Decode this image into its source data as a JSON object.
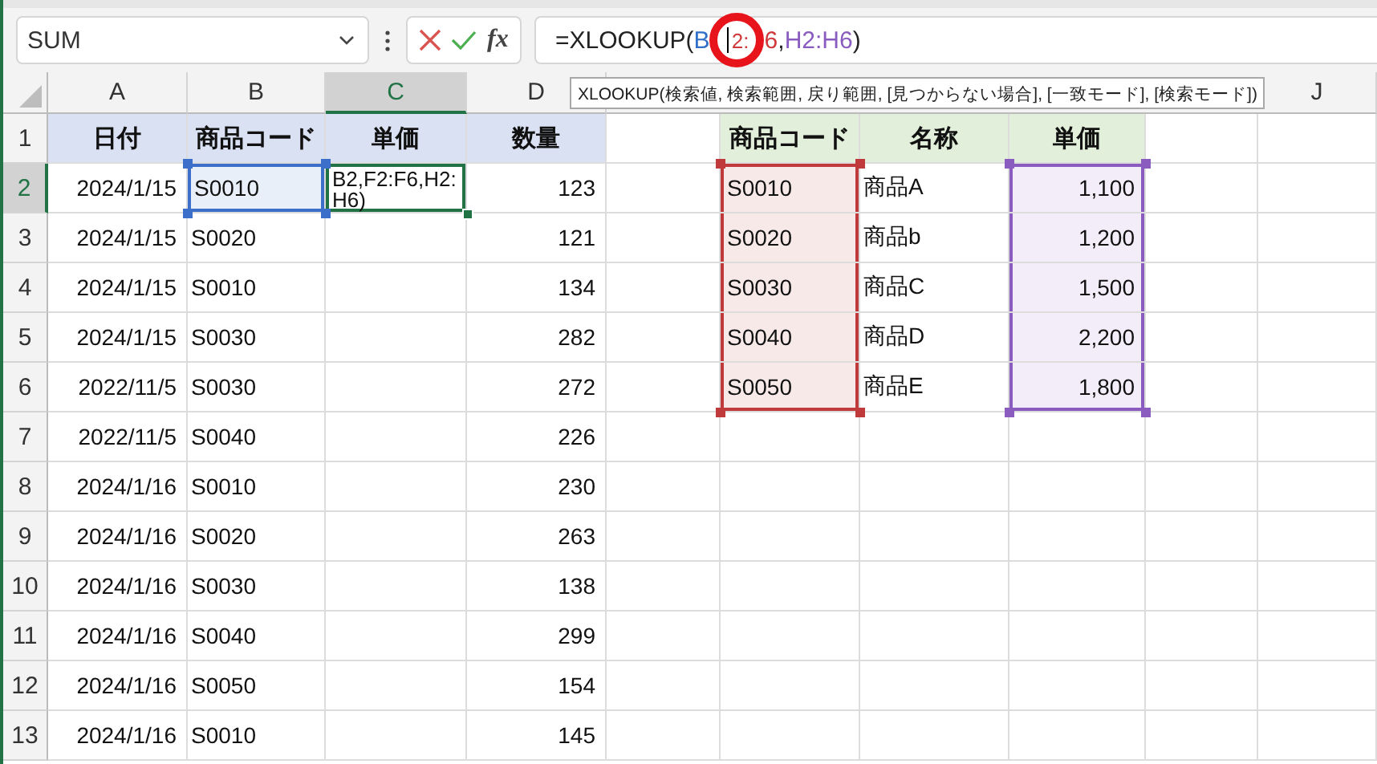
{
  "name_box": {
    "value": "SUM"
  },
  "formula_bar": {
    "function_label": "fx",
    "parts": [
      {
        "text": "=XLOOKUP(",
        "color": "#222222",
        "kind": "plain"
      },
      {
        "text": "B",
        "color": "#2f6fc7",
        "kind": "plain"
      },
      {
        "text": "2:",
        "color": "#d0393b",
        "kind": "circled"
      },
      {
        "text": "6",
        "color": "#d0393b",
        "kind": "plain"
      },
      {
        "text": ",",
        "color": "#222222",
        "kind": "plain"
      },
      {
        "text": "H2:H6",
        "color": "#8a5cc0",
        "kind": "plain"
      },
      {
        "text": ")",
        "color": "#222222",
        "kind": "plain"
      }
    ]
  },
  "tooltip": "XLOOKUP(検索値, 検索範囲, 戻り範囲, [見つからない場合], [一致モード], [検索モード])",
  "columns": [
    {
      "label": "A",
      "selected": false
    },
    {
      "label": "B",
      "selected": false
    },
    {
      "label": "C",
      "selected": true
    },
    {
      "label": "D",
      "selected": false
    },
    {
      "label": "J",
      "selected": false
    }
  ],
  "rows": [
    {
      "number": "1",
      "selected": false,
      "cells": [
        {
          "text": "日付",
          "kind": "header",
          "color": "#d9e1f2"
        },
        {
          "text": "商品コード",
          "kind": "header",
          "color": "#d9e1f2"
        },
        {
          "text": "単価",
          "kind": "header",
          "color": "#d9e1f2"
        },
        {
          "text": "数量",
          "kind": "header",
          "color": "#d9e1f2"
        },
        null,
        {
          "text": "商品コード",
          "kind": "header",
          "color": "#e2efda"
        },
        {
          "text": "名称",
          "kind": "header",
          "color": "#e2efda"
        },
        {
          "text": "単価",
          "kind": "header",
          "color": "#e2efda"
        },
        null,
        null
      ]
    },
    {
      "number": "2",
      "selected": true,
      "cells": [
        {
          "text": "2024/1/15"
        },
        {
          "text": "S0010",
          "kind": "reference",
          "color": "#3b6fc9"
        },
        {
          "text": "B2,F2:F6,H2:H6)"
        },
        {
          "text": "123"
        },
        null,
        {
          "text": "S0010",
          "kind": "reference",
          "color": "#c0393b"
        },
        {
          "text": "商品A"
        },
        {
          "text": "1,100",
          "kind": "reference",
          "color": "#8a5cc0"
        },
        null,
        null
      ]
    },
    {
      "number": "3",
      "selected": false,
      "cells": [
        {
          "text": "2024/1/15"
        },
        {
          "text": "S0020"
        },
        null,
        {
          "text": "121"
        },
        null,
        {
          "text": "S0020",
          "kind": "reference",
          "color": "#c0393b"
        },
        {
          "text": "商品b"
        },
        {
          "text": "1,200",
          "kind": "reference",
          "color": "#8a5cc0"
        },
        null,
        null
      ]
    },
    {
      "number": "4",
      "selected": false,
      "cells": [
        {
          "text": "2024/1/15"
        },
        {
          "text": "S0010"
        },
        null,
        {
          "text": "134"
        },
        null,
        {
          "text": "S0030",
          "kind": "reference",
          "color": "#c0393b"
        },
        {
          "text": "商品C"
        },
        {
          "text": "1,500",
          "kind": "reference",
          "color": "#8a5cc0"
        },
        null,
        null
      ]
    },
    {
      "number": "5",
      "selected": false,
      "cells": [
        {
          "text": "2024/1/15"
        },
        {
          "text": "S0030"
        },
        null,
        {
          "text": "282"
        },
        null,
        {
          "text": "S0040",
          "kind": "reference",
          "color": "#c0393b"
        },
        {
          "text": "商品D"
        },
        {
          "text": "2,200",
          "kind": "reference",
          "color": "#8a5cc0"
        },
        null,
        null
      ]
    },
    {
      "number": "6",
      "selected": false,
      "cells": [
        {
          "text": "2022/11/5"
        },
        {
          "text": "S0030"
        },
        null,
        {
          "text": "272"
        },
        null,
        {
          "text": "S0050",
          "kind": "reference",
          "color": "#c0393b"
        },
        {
          "text": "商品E"
        },
        {
          "text": "1,800",
          "kind": "reference",
          "color": "#8a5cc0"
        },
        null,
        null
      ]
    },
    {
      "number": "7",
      "selected": false,
      "cells": [
        {
          "text": "2022/11/5"
        },
        {
          "text": "S0040"
        },
        null,
        {
          "text": "226"
        },
        null,
        null,
        null,
        null,
        null,
        null
      ]
    },
    {
      "number": "8",
      "selected": false,
      "cells": [
        {
          "text": "2024/1/16"
        },
        {
          "text": "S0010"
        },
        null,
        {
          "text": "230"
        },
        null,
        null,
        null,
        null,
        null,
        null
      ]
    },
    {
      "number": "9",
      "selected": false,
      "cells": [
        {
          "text": "2024/1/16"
        },
        {
          "text": "S0020"
        },
        null,
        {
          "text": "263"
        },
        null,
        null,
        null,
        null,
        null,
        null
      ]
    },
    {
      "number": "10",
      "selected": false,
      "cells": [
        {
          "text": "2024/1/16"
        },
        {
          "text": "S0030"
        },
        null,
        {
          "text": "138"
        },
        null,
        null,
        null,
        null,
        null,
        null
      ]
    },
    {
      "number": "11",
      "selected": false,
      "cells": [
        {
          "text": "2024/1/16"
        },
        {
          "text": "S0040"
        },
        null,
        {
          "text": "299"
        },
        null,
        null,
        null,
        null,
        null,
        null
      ]
    },
    {
      "number": "12",
      "selected": false,
      "cells": [
        {
          "text": "2024/1/16"
        },
        {
          "text": "S0050"
        },
        null,
        {
          "text": "154"
        },
        null,
        null,
        null,
        null,
        null,
        null
      ]
    },
    {
      "number": "13",
      "selected": false,
      "cells": [
        {
          "text": "2024/1/16"
        },
        {
          "text": "S0010"
        },
        null,
        {
          "text": "145"
        },
        null,
        null,
        null,
        null,
        null,
        null
      ]
    }
  ]
}
